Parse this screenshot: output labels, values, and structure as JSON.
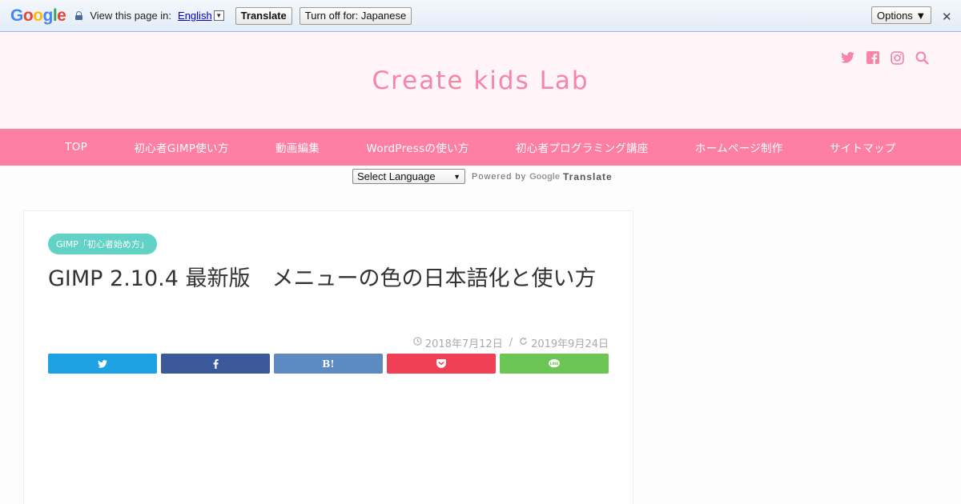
{
  "translate_bar": {
    "logo": [
      "G",
      "o",
      "o",
      "g",
      "l",
      "e"
    ],
    "view_text": "View this page in:",
    "language": "English",
    "translate_label": "Translate",
    "turn_off_label": "Turn off for: Japanese",
    "options_label": "Options ▼"
  },
  "site": {
    "title": "Create kids Lab",
    "social_icons": [
      "twitter-icon",
      "facebook-icon",
      "instagram-icon",
      "search-icon"
    ]
  },
  "nav": {
    "items": [
      "TOP",
      "初心者GIMP使い方",
      "動画編集",
      "WordPressの使い方",
      "初心者プログラミング講座",
      "ホームページ制作",
      "サイトマップ"
    ]
  },
  "language_select": {
    "selected": "Select Language",
    "powered_by": "Powered by",
    "google": "Google",
    "translate": "Translate"
  },
  "article": {
    "category": "GIMP「初心者始め方」",
    "title": "GIMP 2.10.4 最新版　メニューの色の日本語化と使い方",
    "published": "2018年7月12日",
    "separator": "/",
    "updated": "2019年9月24日",
    "share_buttons": [
      {
        "name": "twitter",
        "label": "",
        "color": "#1da1e2"
      },
      {
        "name": "facebook",
        "label": "",
        "color": "#3b5998"
      },
      {
        "name": "hatena",
        "label": "B!",
        "color": "#5d8ac1"
      },
      {
        "name": "pocket",
        "label": "",
        "color": "#ef4056"
      },
      {
        "name": "line",
        "label": "",
        "color": "#6cc655"
      }
    ]
  },
  "colors": {
    "brand_pink": "#f685a8",
    "nav_pink": "#fd7fa4",
    "header_bg": "#fff5f8",
    "category_teal": "#62d2c6"
  }
}
